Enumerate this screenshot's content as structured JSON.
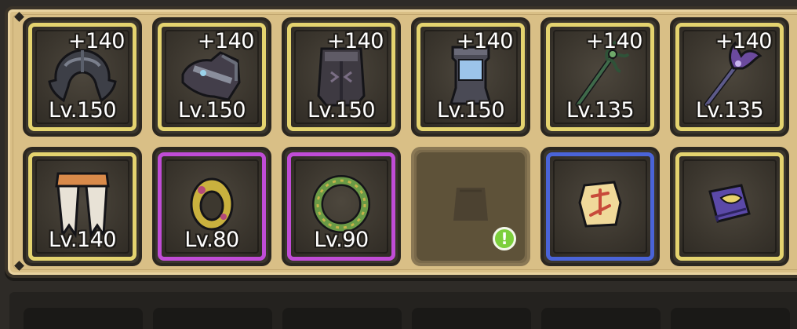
{
  "colors": {
    "rarity_legendary": "#e4d36f",
    "rarity_epic": "#c04cd6",
    "rarity_rare": "#4a64d8",
    "panel": "#d9bf86",
    "alert": "#7ccf3c"
  },
  "equipment": {
    "row1": [
      {
        "icon": "helmet-icon",
        "bonus": "+140",
        "level": "Lv.150",
        "rarity": "legendary"
      },
      {
        "icon": "shoulder-armor-icon",
        "bonus": "+140",
        "level": "Lv.150",
        "rarity": "legendary"
      },
      {
        "icon": "chest-armor-icon",
        "bonus": "+140",
        "level": "Lv.150",
        "rarity": "legendary"
      },
      {
        "icon": "belt-icon",
        "bonus": "+140",
        "level": "Lv.150",
        "rarity": "legendary"
      },
      {
        "icon": "green-staff-icon",
        "bonus": "+140",
        "level": "Lv.135",
        "rarity": "legendary"
      },
      {
        "icon": "purple-staff-icon",
        "bonus": "+140",
        "level": "Lv.135",
        "rarity": "legendary"
      }
    ],
    "row2": [
      {
        "icon": "pants-icon",
        "level": "Lv.140",
        "rarity": "legendary"
      },
      {
        "icon": "gold-ring-icon",
        "level": "Lv.80",
        "rarity": "epic"
      },
      {
        "icon": "leaf-ring-icon",
        "level": "Lv.90",
        "rarity": "epic"
      },
      {
        "icon": "empty-slot-placeholder-icon",
        "alert_icon": "exclamation-icon",
        "alert_text": "!",
        "rarity": "empty"
      },
      {
        "icon": "rune-stone-icon",
        "rarity": "rare"
      },
      {
        "icon": "spellbook-icon",
        "rarity": "legendary"
      }
    ]
  }
}
